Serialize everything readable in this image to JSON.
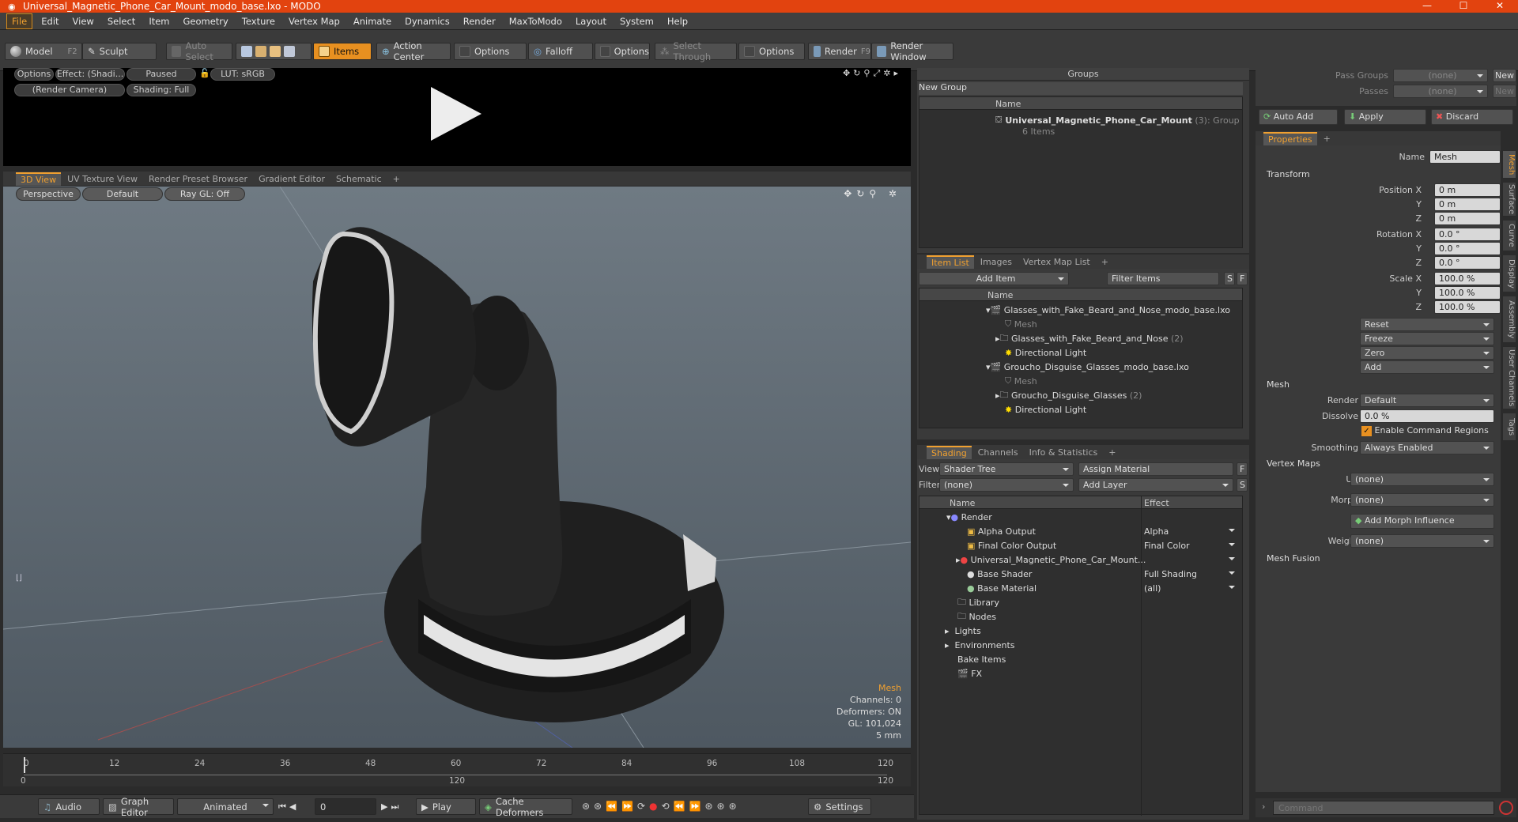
{
  "window": {
    "title": "Universal_Magnetic_Phone_Car_Mount_modo_base.lxo - MODO",
    "controls": [
      "—",
      "☐",
      "✕"
    ]
  },
  "menu": [
    "File",
    "Edit",
    "View",
    "Select",
    "Item",
    "Geometry",
    "Texture",
    "Vertex Map",
    "Animate",
    "Dynamics",
    "Render",
    "MaxToModo",
    "Layout",
    "System",
    "Help"
  ],
  "toolbar": {
    "model": "Model",
    "model_key": "F2",
    "sculpt": "Sculpt",
    "auto_select": "Auto Select",
    "items": "Items",
    "action_center": "Action Center",
    "options1": "Options",
    "falloff": "Falloff",
    "options2": "Options",
    "select_through": "Select Through",
    "options3": "Options",
    "render": "Render",
    "render_key": "F9",
    "render_window": "Render Window"
  },
  "render_preview": {
    "options": "Options",
    "effect": "Effect: (Shadi...",
    "paused": "Paused",
    "lut": "LUT: sRGB",
    "camera": "(Render Camera)",
    "shading": "Shading: Full"
  },
  "viewport_tabs": [
    "3D View",
    "UV Texture View",
    "Render Preset Browser",
    "Gradient Editor",
    "Schematic",
    "+"
  ],
  "viewport": {
    "perspective": "Perspective",
    "default": "Default",
    "raygl": "Ray GL: Off",
    "info": {
      "selection": "Mesh",
      "channels": "Channels: 0",
      "deformers": "Deformers: ON",
      "gl": "GL: 101,024",
      "scale": "5 mm"
    }
  },
  "timeline": {
    "ticks": [
      "0",
      "12",
      "24",
      "36",
      "48",
      "60",
      "72",
      "84",
      "96",
      "108",
      "120"
    ],
    "start": "0",
    "mid": "120",
    "end": "120"
  },
  "transport": {
    "audio": "Audio",
    "graph_editor": "Graph Editor",
    "animated": "Animated",
    "frame": "0",
    "play": "Play",
    "cache": "Cache Deformers",
    "settings": "Settings"
  },
  "groups": {
    "title": "Groups",
    "new_group": "New Group",
    "col_name": "Name",
    "item_name": "Universal_Magnetic_Phone_Car_Mount",
    "item_count": "(3)",
    "item_type": ": Group",
    "item_sub": "6 Items"
  },
  "item_list": {
    "tabs": [
      "Item List",
      "Images",
      "Vertex Map List",
      "+"
    ],
    "add_item": "Add Item",
    "filter": "Filter Items",
    "col_name": "Name",
    "s": "S",
    "f": "F",
    "rows": [
      {
        "label": "Glasses_with_Fake_Beard_and_Nose_modo_base.lxo",
        "count": ""
      },
      {
        "label": "Mesh",
        "count": ""
      },
      {
        "label": "Glasses_with_Fake_Beard_and_Nose",
        "count": "(2)"
      },
      {
        "label": "Directional Light",
        "count": ""
      },
      {
        "label": "Groucho_Disguise_Glasses_modo_base.lxo",
        "count": ""
      },
      {
        "label": "Mesh",
        "count": ""
      },
      {
        "label": "Groucho_Disguise_Glasses",
        "count": "(2)"
      },
      {
        "label": "Directional Light",
        "count": ""
      }
    ]
  },
  "shading": {
    "tabs": [
      "Shading",
      "Channels",
      "Info & Statistics",
      "+"
    ],
    "view_label": "View",
    "view_value": "Shader Tree",
    "assign": "Assign Material",
    "f": "F",
    "filter_label": "Filter",
    "filter_value": "(none)",
    "add_layer": "Add Layer",
    "s": "S",
    "col_name": "Name",
    "col_effect": "Effect",
    "rows": [
      {
        "name": "Render",
        "effect": ""
      },
      {
        "name": "Alpha Output",
        "effect": "Alpha"
      },
      {
        "name": "Final Color Output",
        "effect": "Final Color"
      },
      {
        "name": "Universal_Magnetic_Phone_Car_Mount...",
        "effect": ""
      },
      {
        "name": "Base Shader",
        "effect": "Full Shading"
      },
      {
        "name": "Base Material",
        "effect": "(all)"
      },
      {
        "name": "Library",
        "effect": ""
      },
      {
        "name": "Nodes",
        "effect": ""
      },
      {
        "name": "Lights",
        "effect": ""
      },
      {
        "name": "Environments",
        "effect": ""
      },
      {
        "name": "Bake Items",
        "effect": ""
      },
      {
        "name": "FX",
        "effect": ""
      }
    ]
  },
  "passes": {
    "pass_groups": "Pass Groups",
    "passes": "Passes",
    "none": "(none)",
    "new": "New",
    "auto_add": "Auto Add",
    "apply": "Apply",
    "discard": "Discard"
  },
  "properties": {
    "tab": "Properties",
    "plus": "+",
    "name_label": "Name",
    "name_value": "Mesh",
    "transform": "Transform",
    "position_x": "Position X",
    "rotation_x": "Rotation X",
    "scale_x": "Scale X",
    "y": "Y",
    "z": "Z",
    "pos": [
      "0 m",
      "0 m",
      "0 m"
    ],
    "rot": [
      "0.0 °",
      "0.0 °",
      "0.0 °"
    ],
    "scale": [
      "100.0 %",
      "100.0 %",
      "100.0 %"
    ],
    "reset": "Reset",
    "freeze": "Freeze",
    "zero": "Zero",
    "add": "Add",
    "mesh": "Mesh",
    "render_label": "Render",
    "render_value": "Default",
    "dissolve_label": "Dissolve",
    "dissolve_value": "0.0 %",
    "cmd_regions": "Enable Command Regions",
    "smoothing_label": "Smoothing",
    "smoothing_value": "Always Enabled",
    "vertex_maps": "Vertex Maps",
    "uv_label": "UV",
    "uv_value": "(none)",
    "morph_label": "Morph",
    "morph_value": "(none)",
    "add_morph": "Add Morph Influence",
    "weight_label": "Weight",
    "weight_value": "(none)",
    "mesh_fusion": "Mesh Fusion"
  },
  "side_tabs": [
    "Mesh",
    "Surface",
    "Curve",
    "Display",
    "Assembly",
    "User Channels",
    "Tags"
  ],
  "command": {
    "placeholder": "Command"
  }
}
